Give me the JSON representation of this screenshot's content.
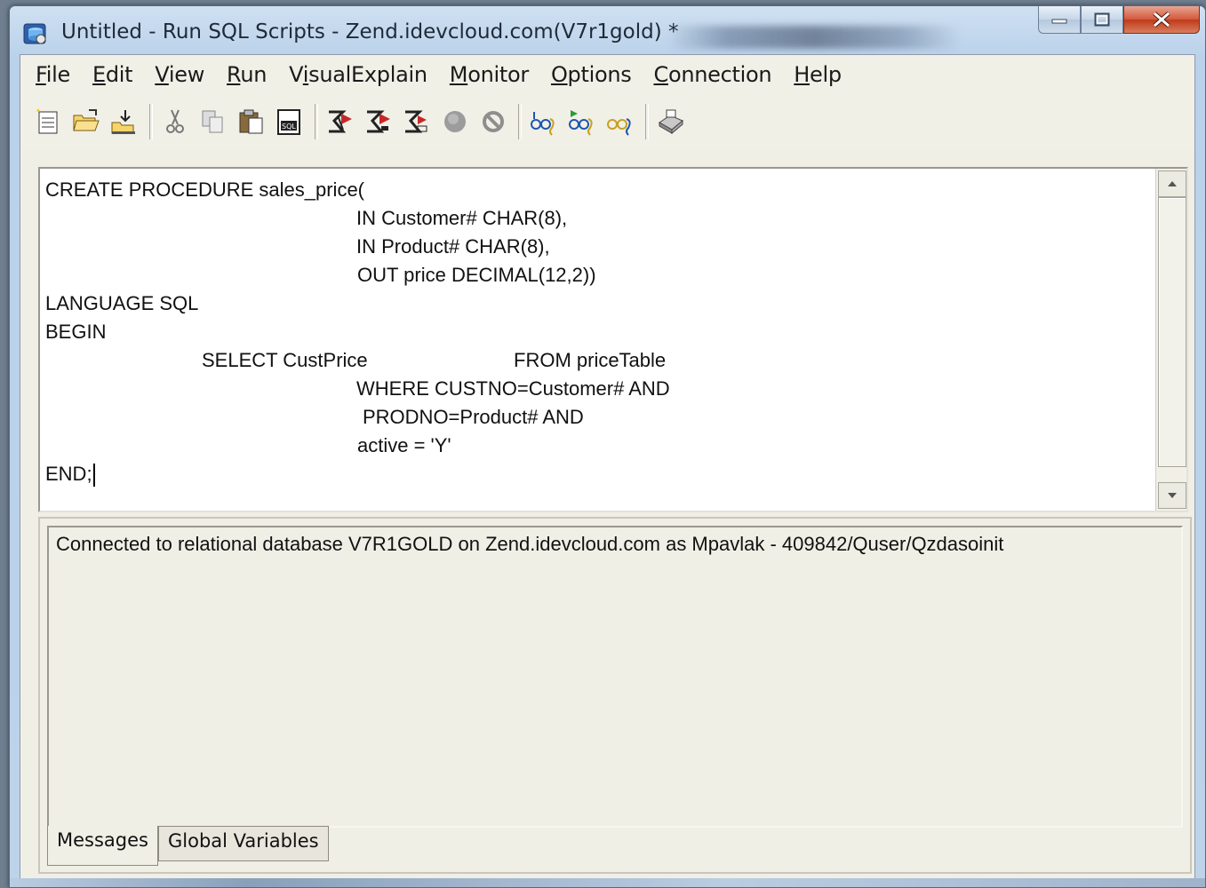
{
  "window": {
    "title": "Untitled - Run SQL Scripts - Zend.idevcloud.com(V7r1gold) *"
  },
  "menubar": {
    "items": [
      "File",
      "Edit",
      "View",
      "Run",
      "VisualExplain",
      "Monitor",
      "Options",
      "Connection",
      "Help"
    ]
  },
  "toolbar": {
    "buttons": [
      "new-icon",
      "open-icon",
      "save-icon",
      "cut-icon",
      "copy-icon",
      "paste-icon",
      "insert-sql-icon",
      "run-all-icon",
      "run-from-selected-icon",
      "run-selected-icon",
      "stop-icon",
      "cancel-icon",
      "explain-icon",
      "run-and-explain-icon",
      "explain-only-icon",
      "print-icon"
    ]
  },
  "editor": {
    "lines": [
      "CREATE PROCEDURE sales_price(",
      "IN Customer# CHAR(8),",
      "IN Product# CHAR(8),",
      "OUT price DECIMAL(12,2))",
      "LANGUAGE SQL",
      "BEGIN",
      "SELECT CustPrice",
      "FROM priceTable",
      "WHERE CUSTNO=Customer# AND",
      "PRODNO=Product# AND",
      "active = 'Y'",
      "END;"
    ]
  },
  "messages": {
    "text": "Connected to relational database V7R1GOLD on Zend.idevcloud.com as Mpavlak - 409842/Quser/Qzdasoinit"
  },
  "tabs": {
    "messages": "Messages",
    "global_variables": "Global Variables"
  }
}
